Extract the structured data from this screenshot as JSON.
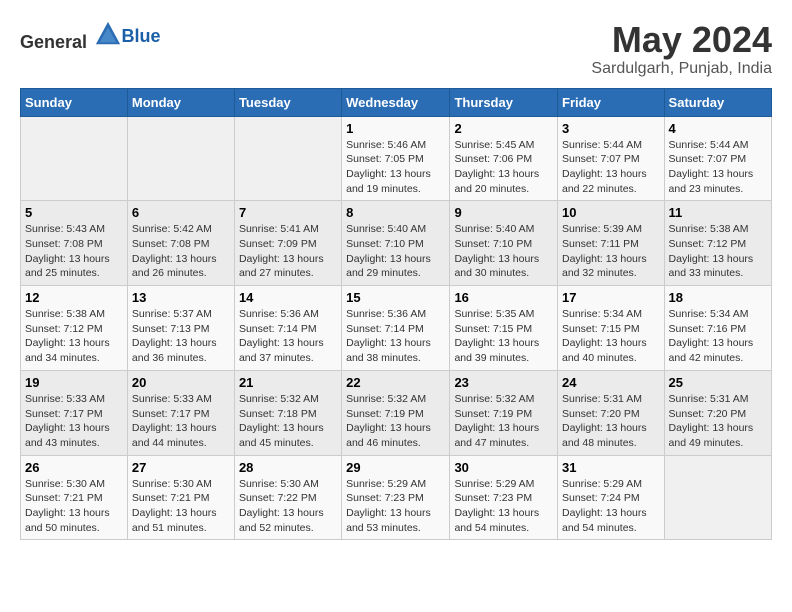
{
  "logo": {
    "general": "General",
    "blue": "Blue"
  },
  "title": "May 2024",
  "subtitle": "Sardulgarh, Punjab, India",
  "weekdays": [
    "Sunday",
    "Monday",
    "Tuesday",
    "Wednesday",
    "Thursday",
    "Friday",
    "Saturday"
  ],
  "weeks": [
    [
      {
        "day": "",
        "info": ""
      },
      {
        "day": "",
        "info": ""
      },
      {
        "day": "",
        "info": ""
      },
      {
        "day": "1",
        "info": "Sunrise: 5:46 AM\nSunset: 7:05 PM\nDaylight: 13 hours\nand 19 minutes."
      },
      {
        "day": "2",
        "info": "Sunrise: 5:45 AM\nSunset: 7:06 PM\nDaylight: 13 hours\nand 20 minutes."
      },
      {
        "day": "3",
        "info": "Sunrise: 5:44 AM\nSunset: 7:07 PM\nDaylight: 13 hours\nand 22 minutes."
      },
      {
        "day": "4",
        "info": "Sunrise: 5:44 AM\nSunset: 7:07 PM\nDaylight: 13 hours\nand 23 minutes."
      }
    ],
    [
      {
        "day": "5",
        "info": "Sunrise: 5:43 AM\nSunset: 7:08 PM\nDaylight: 13 hours\nand 25 minutes."
      },
      {
        "day": "6",
        "info": "Sunrise: 5:42 AM\nSunset: 7:08 PM\nDaylight: 13 hours\nand 26 minutes."
      },
      {
        "day": "7",
        "info": "Sunrise: 5:41 AM\nSunset: 7:09 PM\nDaylight: 13 hours\nand 27 minutes."
      },
      {
        "day": "8",
        "info": "Sunrise: 5:40 AM\nSunset: 7:10 PM\nDaylight: 13 hours\nand 29 minutes."
      },
      {
        "day": "9",
        "info": "Sunrise: 5:40 AM\nSunset: 7:10 PM\nDaylight: 13 hours\nand 30 minutes."
      },
      {
        "day": "10",
        "info": "Sunrise: 5:39 AM\nSunset: 7:11 PM\nDaylight: 13 hours\nand 32 minutes."
      },
      {
        "day": "11",
        "info": "Sunrise: 5:38 AM\nSunset: 7:12 PM\nDaylight: 13 hours\nand 33 minutes."
      }
    ],
    [
      {
        "day": "12",
        "info": "Sunrise: 5:38 AM\nSunset: 7:12 PM\nDaylight: 13 hours\nand 34 minutes."
      },
      {
        "day": "13",
        "info": "Sunrise: 5:37 AM\nSunset: 7:13 PM\nDaylight: 13 hours\nand 36 minutes."
      },
      {
        "day": "14",
        "info": "Sunrise: 5:36 AM\nSunset: 7:14 PM\nDaylight: 13 hours\nand 37 minutes."
      },
      {
        "day": "15",
        "info": "Sunrise: 5:36 AM\nSunset: 7:14 PM\nDaylight: 13 hours\nand 38 minutes."
      },
      {
        "day": "16",
        "info": "Sunrise: 5:35 AM\nSunset: 7:15 PM\nDaylight: 13 hours\nand 39 minutes."
      },
      {
        "day": "17",
        "info": "Sunrise: 5:34 AM\nSunset: 7:15 PM\nDaylight: 13 hours\nand 40 minutes."
      },
      {
        "day": "18",
        "info": "Sunrise: 5:34 AM\nSunset: 7:16 PM\nDaylight: 13 hours\nand 42 minutes."
      }
    ],
    [
      {
        "day": "19",
        "info": "Sunrise: 5:33 AM\nSunset: 7:17 PM\nDaylight: 13 hours\nand 43 minutes."
      },
      {
        "day": "20",
        "info": "Sunrise: 5:33 AM\nSunset: 7:17 PM\nDaylight: 13 hours\nand 44 minutes."
      },
      {
        "day": "21",
        "info": "Sunrise: 5:32 AM\nSunset: 7:18 PM\nDaylight: 13 hours\nand 45 minutes."
      },
      {
        "day": "22",
        "info": "Sunrise: 5:32 AM\nSunset: 7:19 PM\nDaylight: 13 hours\nand 46 minutes."
      },
      {
        "day": "23",
        "info": "Sunrise: 5:32 AM\nSunset: 7:19 PM\nDaylight: 13 hours\nand 47 minutes."
      },
      {
        "day": "24",
        "info": "Sunrise: 5:31 AM\nSunset: 7:20 PM\nDaylight: 13 hours\nand 48 minutes."
      },
      {
        "day": "25",
        "info": "Sunrise: 5:31 AM\nSunset: 7:20 PM\nDaylight: 13 hours\nand 49 minutes."
      }
    ],
    [
      {
        "day": "26",
        "info": "Sunrise: 5:30 AM\nSunset: 7:21 PM\nDaylight: 13 hours\nand 50 minutes."
      },
      {
        "day": "27",
        "info": "Sunrise: 5:30 AM\nSunset: 7:21 PM\nDaylight: 13 hours\nand 51 minutes."
      },
      {
        "day": "28",
        "info": "Sunrise: 5:30 AM\nSunset: 7:22 PM\nDaylight: 13 hours\nand 52 minutes."
      },
      {
        "day": "29",
        "info": "Sunrise: 5:29 AM\nSunset: 7:23 PM\nDaylight: 13 hours\nand 53 minutes."
      },
      {
        "day": "30",
        "info": "Sunrise: 5:29 AM\nSunset: 7:23 PM\nDaylight: 13 hours\nand 54 minutes."
      },
      {
        "day": "31",
        "info": "Sunrise: 5:29 AM\nSunset: 7:24 PM\nDaylight: 13 hours\nand 54 minutes."
      },
      {
        "day": "",
        "info": ""
      }
    ]
  ]
}
